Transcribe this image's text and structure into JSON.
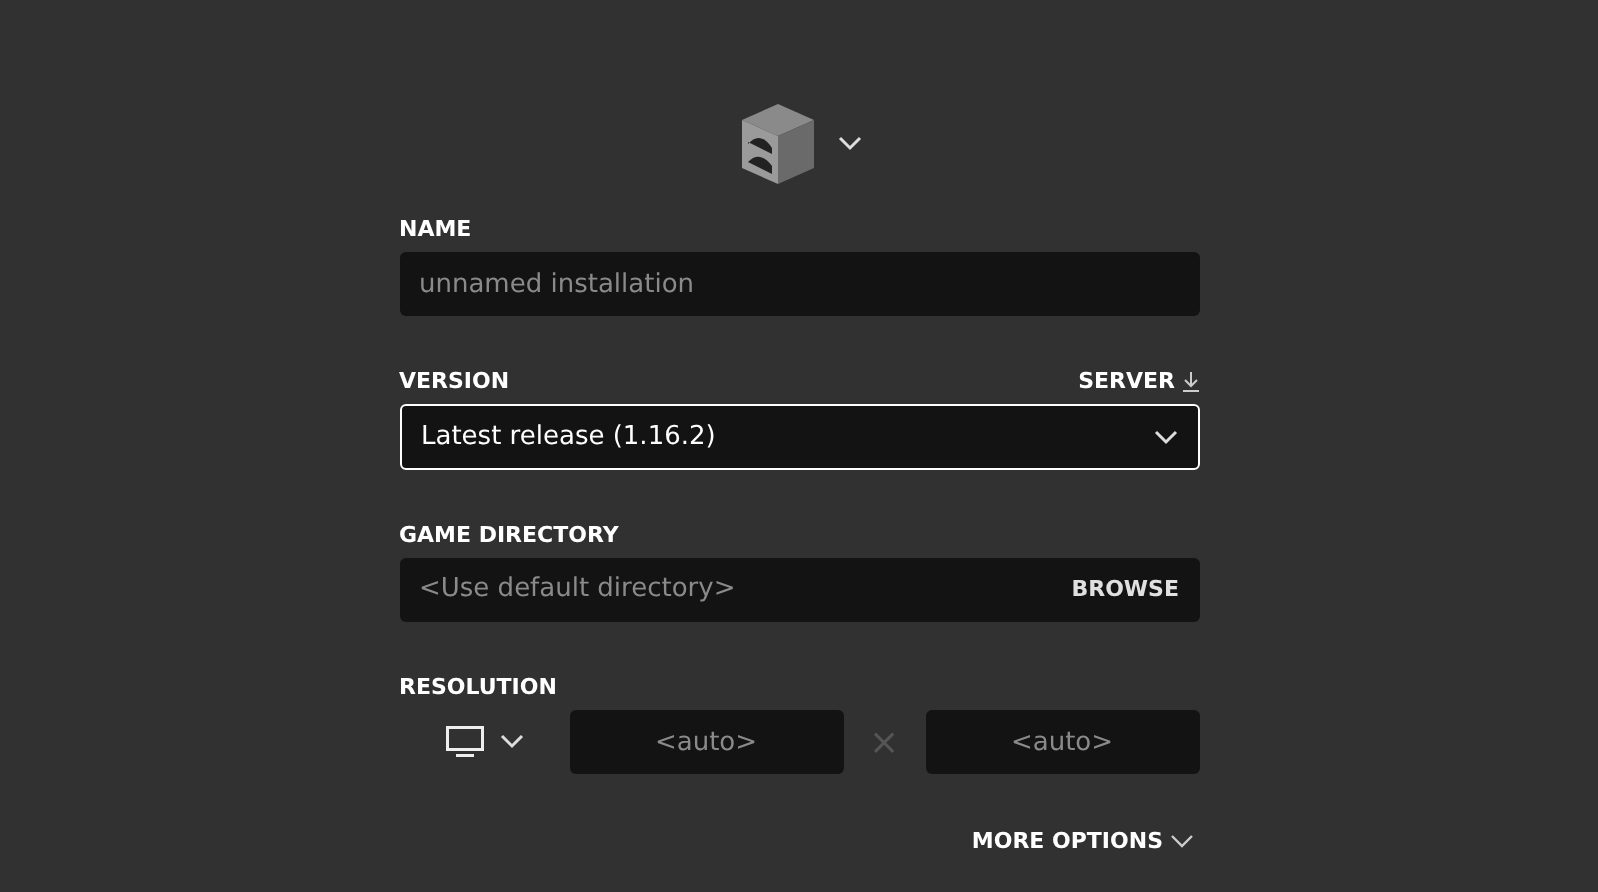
{
  "icon_picker": {
    "expanded": false
  },
  "name": {
    "label": "NAME",
    "placeholder": "unnamed installation"
  },
  "version": {
    "label": "VERSION",
    "server_link": "SERVER",
    "value": "Latest release (1.16.2)",
    "focused": true
  },
  "game_directory": {
    "label": "GAME DIRECTORY",
    "placeholder": "<Use default directory>",
    "button": "BROWSE"
  },
  "resolution": {
    "label": "RESOLUTION",
    "width_placeholder": "<auto>",
    "separator": "×",
    "height_placeholder": "<auto>"
  },
  "more_options": {
    "label": "MORE OPTIONS",
    "expanded": false
  }
}
